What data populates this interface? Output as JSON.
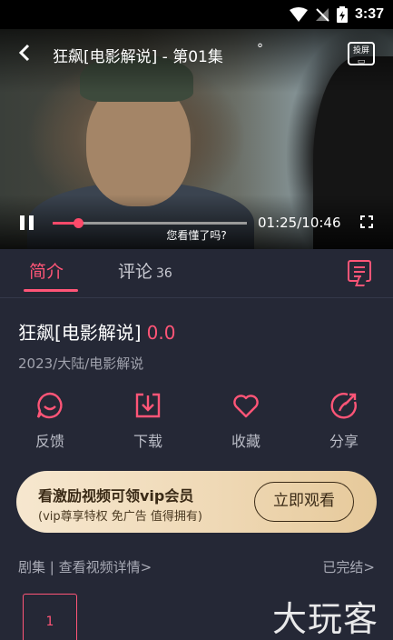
{
  "status_bar": {
    "time": "3:37",
    "icons": [
      "wifi-icon",
      "no-signal-icon",
      "battery-charging-icon"
    ]
  },
  "player": {
    "title": "狂飙[电影解说] - 第01集",
    "dot": "°",
    "cast_label_line1": "投屏",
    "cast_label_line2": "▭",
    "current_time": "01:25",
    "duration": "10:46",
    "time_display": "01:25/10:46",
    "progress_fraction": 0.13,
    "subtitle": "您看懂了吗?",
    "accent_color": "#ff4a6a"
  },
  "tabs": [
    {
      "label": "简介",
      "active": true
    },
    {
      "label": "评论",
      "count": "36",
      "active": false
    }
  ],
  "info": {
    "title": "狂飙[电影解说]",
    "score": "0.0",
    "meta": "2023/大陆/电影解说"
  },
  "actions": [
    {
      "label": "反馈",
      "icon": "feedback-icon"
    },
    {
      "label": "下载",
      "icon": "download-icon"
    },
    {
      "label": "收藏",
      "icon": "heart-icon"
    },
    {
      "label": "分享",
      "icon": "share-icon"
    }
  ],
  "vip_banner": {
    "title": "看激励视频可领vip会员",
    "subtitle": "(vip尊享特权 免广告 值得拥有)",
    "button": "立即观看"
  },
  "episodes": {
    "left_label": "剧集 | 查看视频详情>",
    "right_label": "已完结>",
    "items": [
      "1"
    ]
  },
  "watermark": "大玩客",
  "colors": {
    "accent": "#ff5577",
    "background": "#252836",
    "vip_gold": "#efd9b6"
  }
}
